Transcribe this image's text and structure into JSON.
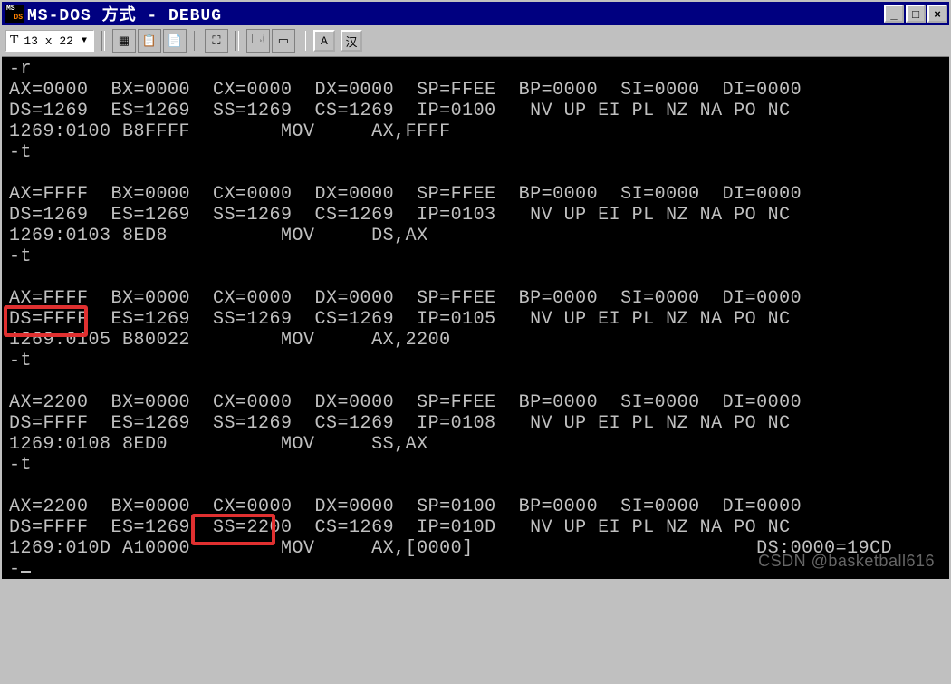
{
  "window": {
    "title": "MS-DOS 方式 - DEBUG",
    "icon_top": "MS",
    "icon_bottom": "DS"
  },
  "winbuttons": {
    "min": "_",
    "max": "□",
    "close": "×"
  },
  "toolbar": {
    "font_icon": "T",
    "font_label": "13 x 22",
    "drop": "▼",
    "btn_mark": "▦",
    "btn_copy": "📋",
    "btn_paste": "📄",
    "btn_full": "⛶",
    "btn_props": "🗔",
    "btn_bg": "▭",
    "btn_font": "A",
    "btn_cn": "汉"
  },
  "terminal": {
    "lines": [
      "-r",
      "AX=0000  BX=0000  CX=0000  DX=0000  SP=FFEE  BP=0000  SI=0000  DI=0000",
      "DS=1269  ES=1269  SS=1269  CS=1269  IP=0100   NV UP EI PL NZ NA PO NC",
      "1269:0100 B8FFFF        MOV     AX,FFFF",
      "-t",
      "",
      "AX=FFFF  BX=0000  CX=0000  DX=0000  SP=FFEE  BP=0000  SI=0000  DI=0000",
      "DS=1269  ES=1269  SS=1269  CS=1269  IP=0103   NV UP EI PL NZ NA PO NC",
      "1269:0103 8ED8          MOV     DS,AX",
      "-t",
      "",
      "AX=FFFF  BX=0000  CX=0000  DX=0000  SP=FFEE  BP=0000  SI=0000  DI=0000",
      "DS=FFFF  ES=1269  SS=1269  CS=1269  IP=0105   NV UP EI PL NZ NA PO NC",
      "1269:0105 B80022        MOV     AX,2200",
      "-t",
      "",
      "AX=2200  BX=0000  CX=0000  DX=0000  SP=FFEE  BP=0000  SI=0000  DI=0000",
      "DS=FFFF  ES=1269  SS=1269  CS=1269  IP=0108   NV UP EI PL NZ NA PO NC",
      "1269:0108 8ED0          MOV     SS,AX",
      "-t",
      "",
      "AX=2200  BX=0000  CX=0000  DX=0000  SP=0100  BP=0000  SI=0000  DI=0000",
      "DS=FFFF  ES=1269  SS=2200  CS=1269  IP=010D   NV UP EI PL NZ NA PO NC",
      "1269:010D A10000        MOV     AX,[0000]                         DS:0000=19CD",
      "-"
    ]
  },
  "highlights": [
    {
      "text": "DS=FFFF",
      "line": 12,
      "col": 0
    },
    {
      "text": "SS=2200",
      "line": 22,
      "col": 18
    }
  ],
  "watermark": "CSDN @basketball616"
}
